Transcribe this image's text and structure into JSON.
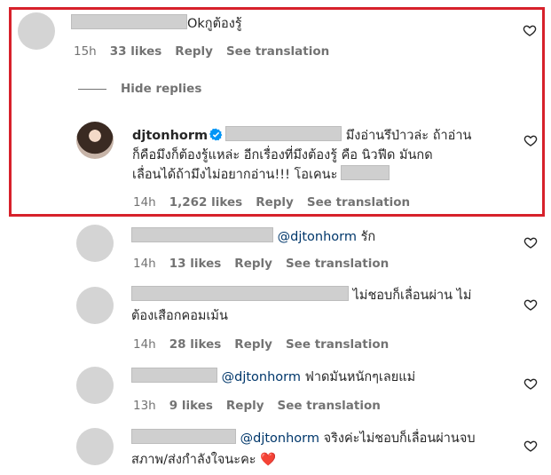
{
  "comments": [
    {
      "text": "Okกูต้องรู้",
      "time": "15h",
      "likes": "33 likes",
      "reply": "Reply",
      "translate": "See translation"
    },
    {
      "username": "djtonhorm",
      "line1": "มึงอ่านรึป่าวล่ะ ถ้าอ่าน",
      "line2": "ก็คือมึงก็ต้องรู้แหล่ะ อีกเรื่องที่มึงต้องรู้ คือ นิวฟีด มันกด",
      "line3": "เลื่อนได้ถ้ามึงไม่อยากอ่าน!!! โอเคนะ",
      "time": "14h",
      "likes": "1,262 likes",
      "reply": "Reply",
      "translate": "See translation"
    },
    {
      "mention": "@djtonhorm",
      "text": "รัก",
      "time": "14h",
      "likes": "13 likes",
      "reply": "Reply",
      "translate": "See translation"
    },
    {
      "line1": "ไม่ชอบก็เลื่อนผ่าน ไม่",
      "line2": "ต้องเสือกคอมเม้น",
      "time": "14h",
      "likes": "28 likes",
      "reply": "Reply",
      "translate": "See translation"
    },
    {
      "mention": "@djtonhorm",
      "text": "ฟาดมันหนักๆเลยแม่",
      "time": "13h",
      "likes": "9 likes",
      "reply": "Reply",
      "translate": "See translation"
    },
    {
      "mention": "@djtonhorm",
      "line1": "จริงค่ะไม่ชอบก็เลื่อนผ่านจบ",
      "line2": "สภาพ/ส่งกำลังใจนะคะ",
      "emoji": "❤️"
    }
  ],
  "hide_replies": "Hide replies",
  "colors": {
    "highlight": "#d7212b",
    "verified": "#0095f6",
    "heart_emoji": "#e0245e"
  }
}
